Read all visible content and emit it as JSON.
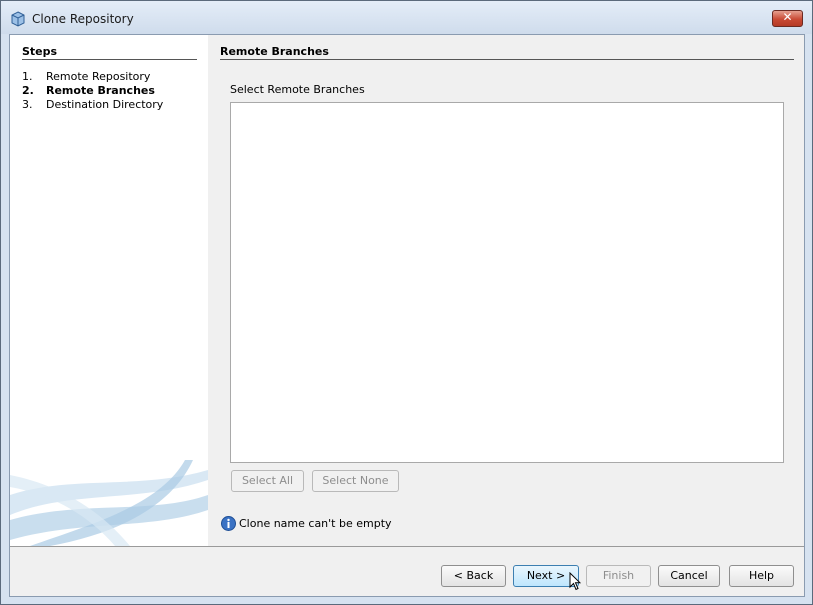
{
  "window": {
    "title": "Clone Repository",
    "close_label": "✕"
  },
  "steps": {
    "title": "Steps",
    "items": [
      {
        "num": "1.",
        "label": "Remote Repository"
      },
      {
        "num": "2.",
        "label": "Remote Branches"
      },
      {
        "num": "3.",
        "label": "Destination Directory"
      }
    ],
    "active_index": 1
  },
  "panel": {
    "title": "Remote Branches",
    "list_label": "Select Remote Branches",
    "branches": [],
    "select_all": "Select All",
    "select_none": "Select None",
    "message": "Clone name can't be empty"
  },
  "buttons": {
    "back": "< Back",
    "next": "Next >",
    "finish": "Finish",
    "cancel": "Cancel",
    "help": "Help"
  },
  "icons": {
    "app": "repository-cube-icon",
    "close": "close-icon",
    "info": "info-icon",
    "cursor": "mouse-pointer-icon"
  },
  "colors": {
    "titlebar": "#cfdcec",
    "close_button": "#c94a35",
    "info_icon": "#3a72c4",
    "swoosh": "#bcd6ea"
  }
}
